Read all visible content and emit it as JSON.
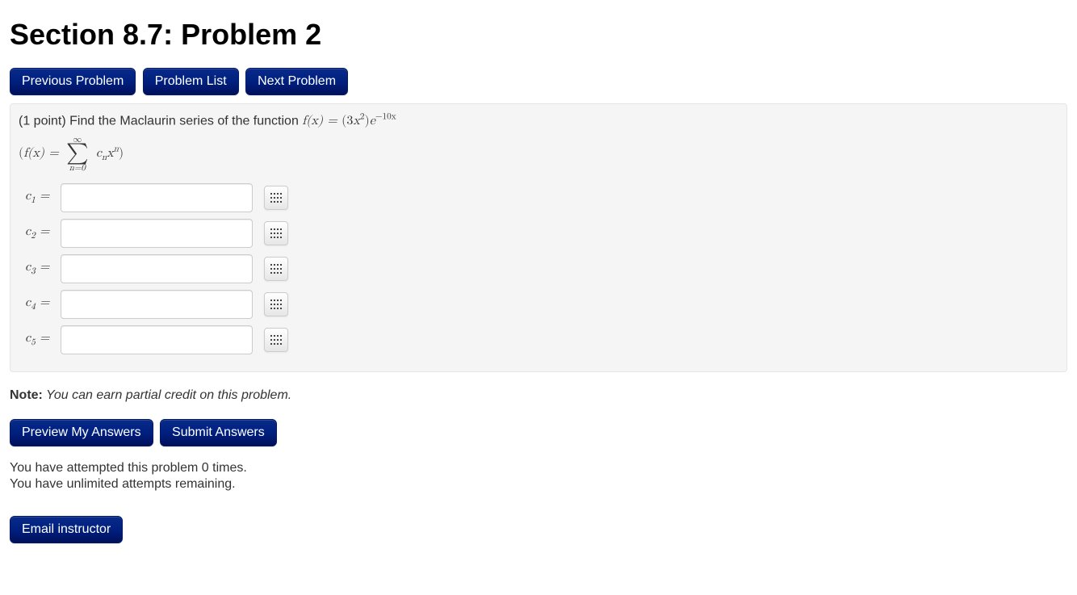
{
  "title": "Section 8.7: Problem 2",
  "nav": {
    "prev": "Previous Problem",
    "list": "Problem List",
    "next": "Next Problem"
  },
  "problem": {
    "points_prefix": "(1 point) Find the Maclaurin series of the function ",
    "func_lhs": "f(x) = ",
    "func_rhs_coef": "(3",
    "func_rhs_var": "x",
    "func_rhs_exp": "2",
    "func_rhs_close": ")",
    "func_rhs_e": "e",
    "func_rhs_eexp": "−10x",
    "series_open": "(",
    "series_lhs": "f(x) = ",
    "sum_top": "∞",
    "sum_bot": "n=0",
    "series_term_c": "c",
    "series_term_csub": "n",
    "series_term_x": "x",
    "series_term_xexp": "n",
    "series_close": ")"
  },
  "answers": [
    {
      "label_c": "c",
      "label_sub": "1",
      "label_eq": " =",
      "value": ""
    },
    {
      "label_c": "c",
      "label_sub": "2",
      "label_eq": " =",
      "value": ""
    },
    {
      "label_c": "c",
      "label_sub": "3",
      "label_eq": " =",
      "value": ""
    },
    {
      "label_c": "c",
      "label_sub": "4",
      "label_eq": " =",
      "value": ""
    },
    {
      "label_c": "c",
      "label_sub": "5",
      "label_eq": " =",
      "value": ""
    }
  ],
  "note": {
    "label": "Note:",
    "text": " You can earn partial credit on this problem."
  },
  "actions": {
    "preview": "Preview My Answers",
    "submit": "Submit Answers"
  },
  "status": {
    "attempted": "You have attempted this problem 0 times.",
    "remaining": "You have unlimited attempts remaining."
  },
  "footer": {
    "email": "Email instructor"
  }
}
